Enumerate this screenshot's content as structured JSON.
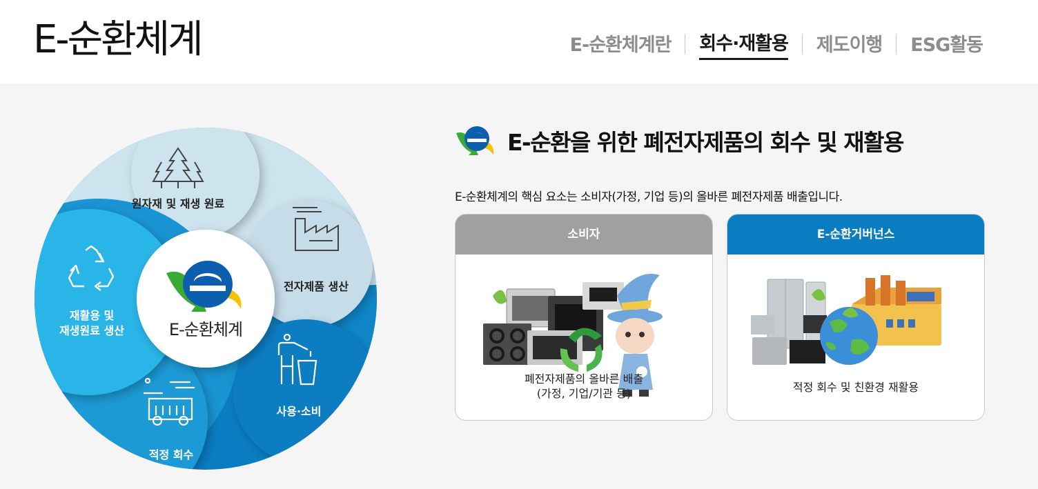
{
  "header": {
    "site_title": "E-순환체계",
    "nav": [
      {
        "label": "E-순환체계란",
        "active": false
      },
      {
        "label": "회수·재활용",
        "active": true
      },
      {
        "label": "제도이행",
        "active": false
      },
      {
        "label": "ESG활동",
        "active": false
      }
    ]
  },
  "cycle": {
    "center_label": "E-순환체계",
    "stages": [
      {
        "label": "원자재 및 재생 원료",
        "icon": "trees-icon"
      },
      {
        "label": "전자제품 생산",
        "icon": "factory-icon"
      },
      {
        "label": "사용·소비",
        "icon": "person-trash-icon"
      },
      {
        "label": "적정 회수",
        "icon": "truck-icon"
      },
      {
        "label_line1": "재활용 및",
        "label_line2": "재생원료 생산",
        "icon": "recycle-icon"
      }
    ]
  },
  "section": {
    "title": "E-순환을 위한 폐전자제품의 회수 및 재활용",
    "description": "E-순환체계의 핵심 요소는 소비자(가정, 기업 등)의 올바른 폐전자제품 배출입니다."
  },
  "cards": [
    {
      "header": "소비자",
      "header_color": "#a0a0a0",
      "caption_line1": "폐전자제품의 올바른 배출",
      "caption_line2": "(가정, 기업/기관 등)"
    },
    {
      "header": "E-순환거버넌스",
      "header_color": "#0a7dc2",
      "caption_line1": "적정 회수 및 친환경 재활용"
    }
  ],
  "colors": {
    "light_segment": "#cde3ee",
    "sky_segment": "#29b5e8",
    "mid_segment": "#1e9ad6",
    "deep_segment": "#0a7dc2",
    "active_nav": "#1a1a1a",
    "inactive_nav": "#8c8c8c"
  }
}
